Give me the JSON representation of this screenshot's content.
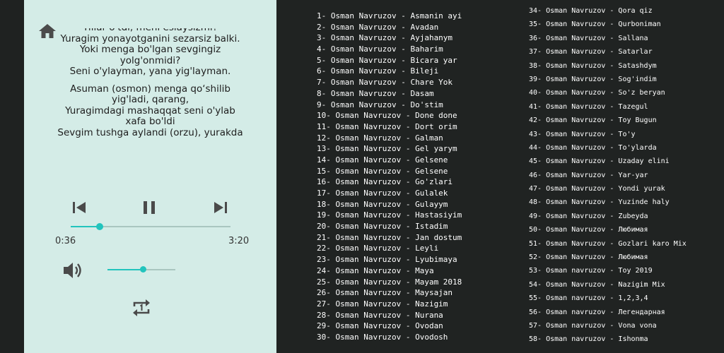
{
  "colors": {
    "accent": "#22c4bd",
    "player_bg": "#d4ece7",
    "list_bg": "#202322"
  },
  "player": {
    "home_icon": "home-icon",
    "lyrics": [
      [
        "Yillar o'tdi, meni eslaysizmi?",
        "Yuragim yonayotganini sezarsiz balki.",
        "Yoki menga bo'lgan sevgingiz",
        "yolg'onmidi?",
        "Seni o'ylayman, yana yig'layman."
      ],
      [
        "Asuman (osmon) menga qo‘shilib",
        "yig'ladi, qarang,",
        "Yuragimdagi mashaqqat seni o'ylab",
        "xafa bo'ldi",
        "Sevgim tushga aylandi (orzu), yurakda"
      ]
    ],
    "progress_fraction": 0.18,
    "current_time": "0:36",
    "total_time": "3:20",
    "volume_fraction": 0.53,
    "icons": {
      "prev": "skip-previous-icon",
      "pause": "pause-icon",
      "next": "skip-next-icon",
      "volume": "volume-icon",
      "repeat": "repeat-one-icon"
    }
  },
  "playlist": {
    "column1": [
      "1- Osman Navruzov - Asmanin ayi",
      "2- Osman Navruzov - Avadan",
      "3- Osman Navruzov - Ayjahanym",
      "4- Osman Navruzov - Baharim",
      "5- Osman Navruzov - Bicara yar",
      "6- Osman Navruzov - Bileji",
      "7- Osman Navruzov - Chare Yok",
      "8- Osman Navruzov - Dasam",
      "9- Osman Navruzov - Do'stim",
      "10- Osman Navruzov - Done done",
      "11- Osman Navruzov - Dort orim",
      "12- Osman Navruzov - Galman",
      "13- Osman Navruzov - Gel yarym",
      "14- Osman Navruzov - Gelsene",
      "15- Osman Navruzov - Gelsene",
      "16- Osman Navruzov - Go'zlari",
      "17- Osman Navruzov - Gulalek",
      "18- Osman Navruzov - Gulayym",
      "19- Osman Navruzov - Hastasiyim",
      "20- Osman Navruzov - Istadim",
      "21- Osman Navruzov - Jan dostum",
      "22- Osman Navruzov - Leyli",
      "23- Osman Navruzov - Lyubimaya",
      "24- Osman Navruzov - Maya",
      "25- Osman Navruzov - Mayam 2018",
      "26- Osman Navruzov - Maysajan",
      "27- Osman Navruzov - Nazigim",
      "28- Osman Navruzov - Nurana",
      "29- Osman Navruzov - Ovodan",
      "30- Osman Navruzov - Ovodosh"
    ],
    "column2": [
      "34- Osman Navruzov - Qora qiz",
      "35- Osman Navruzov - Qurboniman",
      "36- Osman Navruzov - Sallana",
      "37- Osman Navruzov - Satarlar",
      "38- Osman Navruzov - Satashdym",
      "39- Osman Navruzov - Sog'indim",
      "40- Osman Navruzov - So'z beryan",
      "41- Osman Navruzov - Tazegul",
      "42- Osman Navruzov - Toy Bugun",
      "43- Osman Navruzov - To'y",
      "44- Osman Navruzov - To'ylarda",
      "45- Osman Navruzov - Uzaday elini",
      "46- Osman Navruzov - Yar-yar",
      "47- Osman Navruzov - Yondi yurak",
      "48- Osman Navruzov - Yuzinde haly",
      "49- Osman Navruzov - Zubeyda",
      "50- Osman Navruzov - Любимая",
      "51- Osman Navruzov - Gozlari karo Mix",
      "52- Osman Navruzov - Любимая",
      "53- Osman navruzov - Toy 2019",
      "54- Osman Navruzov - Nazigim Mix",
      "55- Osman navruzov - 1,2,3,4",
      "56- Osman navruzov - Легендарная",
      "57- Osman navruzov - Vona vona",
      "58- Osman navruzov - Ishonma"
    ]
  }
}
